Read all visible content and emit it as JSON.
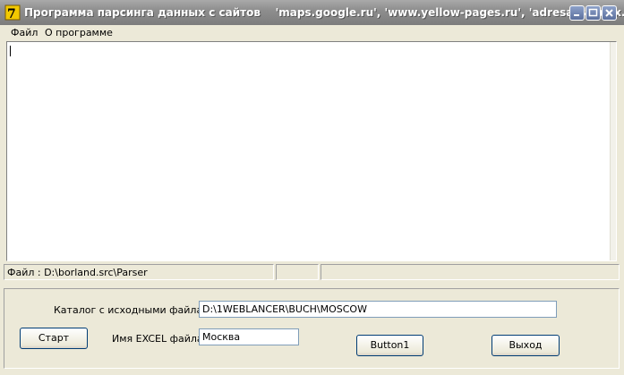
{
  "window": {
    "title": "Программа парсинга данных с сайтов    'maps.google.ru', 'www.yellow-pages.ru', 'adresa.yandex.ru'"
  },
  "menu": [
    "Файл",
    "О программе"
  ],
  "statusbar": {
    "panels": [
      "Файл : D:\\borland.src\\Parser",
      "",
      ""
    ]
  },
  "form": {
    "catalog_label": "Каталог с исходными файлами",
    "catalog_value": "D:\\1WEBLANCER\\BUCH\\MOSCOW",
    "excel_label": "Имя EXCEL файла",
    "excel_value": "Москва",
    "start_button": "Старт",
    "button1": "Button1",
    "exit_button": "Выход"
  }
}
